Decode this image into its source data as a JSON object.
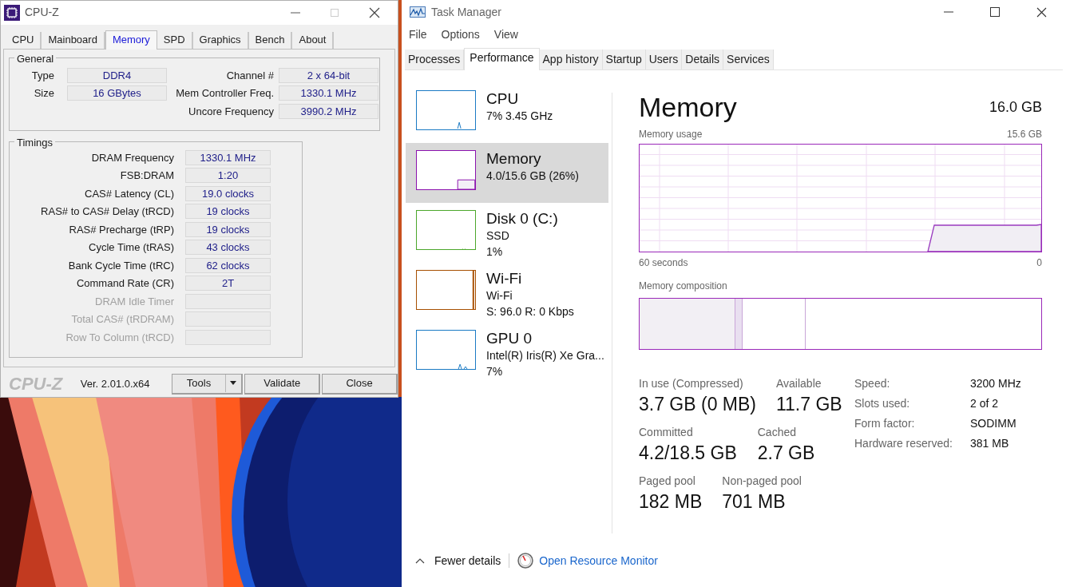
{
  "cpuz": {
    "title": "CPU-Z",
    "tabs": [
      {
        "label": "CPU",
        "selected": false
      },
      {
        "label": "Mainboard",
        "selected": false
      },
      {
        "label": "Memory",
        "selected": true
      },
      {
        "label": "SPD",
        "selected": false
      },
      {
        "label": "Graphics",
        "selected": false
      },
      {
        "label": "Bench",
        "selected": false
      },
      {
        "label": "About",
        "selected": false
      }
    ],
    "general": {
      "title": "General",
      "left": [
        {
          "label": "Type",
          "value": "DDR4"
        },
        {
          "label": "Size",
          "value": "16 GBytes"
        }
      ],
      "right": [
        {
          "label": "Channel #",
          "value": "2 x 64-bit"
        },
        {
          "label": "Mem Controller Freq.",
          "value": "1330.1 MHz"
        },
        {
          "label": "Uncore Frequency",
          "value": "3990.2 MHz"
        }
      ]
    },
    "timings": {
      "title": "Timings",
      "rows": [
        {
          "label": "DRAM Frequency",
          "value": "1330.1 MHz",
          "disabled": false
        },
        {
          "label": "FSB:DRAM",
          "value": "1:20",
          "disabled": false
        },
        {
          "label": "CAS# Latency (CL)",
          "value": "19.0 clocks",
          "disabled": false
        },
        {
          "label": "RAS# to CAS# Delay (tRCD)",
          "value": "19 clocks",
          "disabled": false
        },
        {
          "label": "RAS# Precharge (tRP)",
          "value": "19 clocks",
          "disabled": false
        },
        {
          "label": "Cycle Time (tRAS)",
          "value": "43 clocks",
          "disabled": false
        },
        {
          "label": "Bank Cycle Time (tRC)",
          "value": "62 clocks",
          "disabled": false
        },
        {
          "label": "Command Rate (CR)",
          "value": "2T",
          "disabled": false
        },
        {
          "label": "DRAM Idle Timer",
          "disabled": true
        },
        {
          "label": "Total CAS# (tRDRAM)",
          "disabled": true
        },
        {
          "label": "Row To Column (tRCD)",
          "disabled": true
        }
      ]
    },
    "footer": {
      "logo": "CPU-Z",
      "version": "Ver. 2.01.0.x64",
      "buttons": [
        "Tools",
        "Validate",
        "Close"
      ]
    }
  },
  "taskmanager": {
    "title": "Task Manager",
    "menu": [
      "File",
      "Options",
      "View"
    ],
    "tabs": [
      {
        "label": "Processes",
        "selected": false
      },
      {
        "label": "Performance",
        "selected": true
      },
      {
        "label": "App history",
        "selected": false
      },
      {
        "label": "Startup",
        "selected": false
      },
      {
        "label": "Users",
        "selected": false
      },
      {
        "label": "Details",
        "selected": false
      },
      {
        "label": "Services",
        "selected": false
      }
    ],
    "sidebar": [
      {
        "name": "CPU",
        "lines": [
          "7%  3.45 GHz"
        ],
        "color": "#1a7ac4",
        "selected": false
      },
      {
        "name": "Memory",
        "lines": [
          "4.0/15.6 GB (26%)"
        ],
        "color": "#8b12ae",
        "selected": true
      },
      {
        "name": "Disk 0 (C:)",
        "lines": [
          "SSD",
          "1%"
        ],
        "color": "#4ca72b",
        "selected": false
      },
      {
        "name": "Wi-Fi",
        "lines": [
          "Wi-Fi",
          "S: 96.0 R: 0 Kbps"
        ],
        "color": "#a74f01",
        "selected": false
      },
      {
        "name": "GPU 0",
        "lines": [
          "Intel(R) Iris(R) Xe Gra...",
          "7%"
        ],
        "color": "#1a7ac4",
        "selected": false
      }
    ],
    "detail": {
      "title": "Memory",
      "total": "16.0 GB",
      "usage_label": "Memory usage",
      "usage_max": "15.6 GB",
      "x_start": "60 seconds",
      "x_end": "0",
      "composition_label": "Memory composition",
      "stat_rows": [
        [
          {
            "label": "In use (Compressed)",
            "value": "3.7 GB (0 MB)"
          },
          {
            "label": "Available",
            "value": "11.7 GB"
          }
        ],
        [
          {
            "label": "Committed",
            "value": "4.2/18.5 GB"
          },
          {
            "label": "Cached",
            "value": "2.7 GB"
          }
        ],
        [
          {
            "label": "Paged pool",
            "value": "182 MB"
          },
          {
            "label": "Non-paged pool",
            "value": "701 MB"
          }
        ]
      ],
      "specs": [
        {
          "label": "Speed:",
          "value": "3200 MHz"
        },
        {
          "label": "Slots used:",
          "value": "2 of 2"
        },
        {
          "label": "Form factor:",
          "value": "SODIMM"
        },
        {
          "label": "Hardware reserved:",
          "value": "381 MB"
        }
      ]
    },
    "footer": {
      "fewer_details": "Fewer details",
      "resource_monitor": "Open Resource Monitor"
    }
  }
}
